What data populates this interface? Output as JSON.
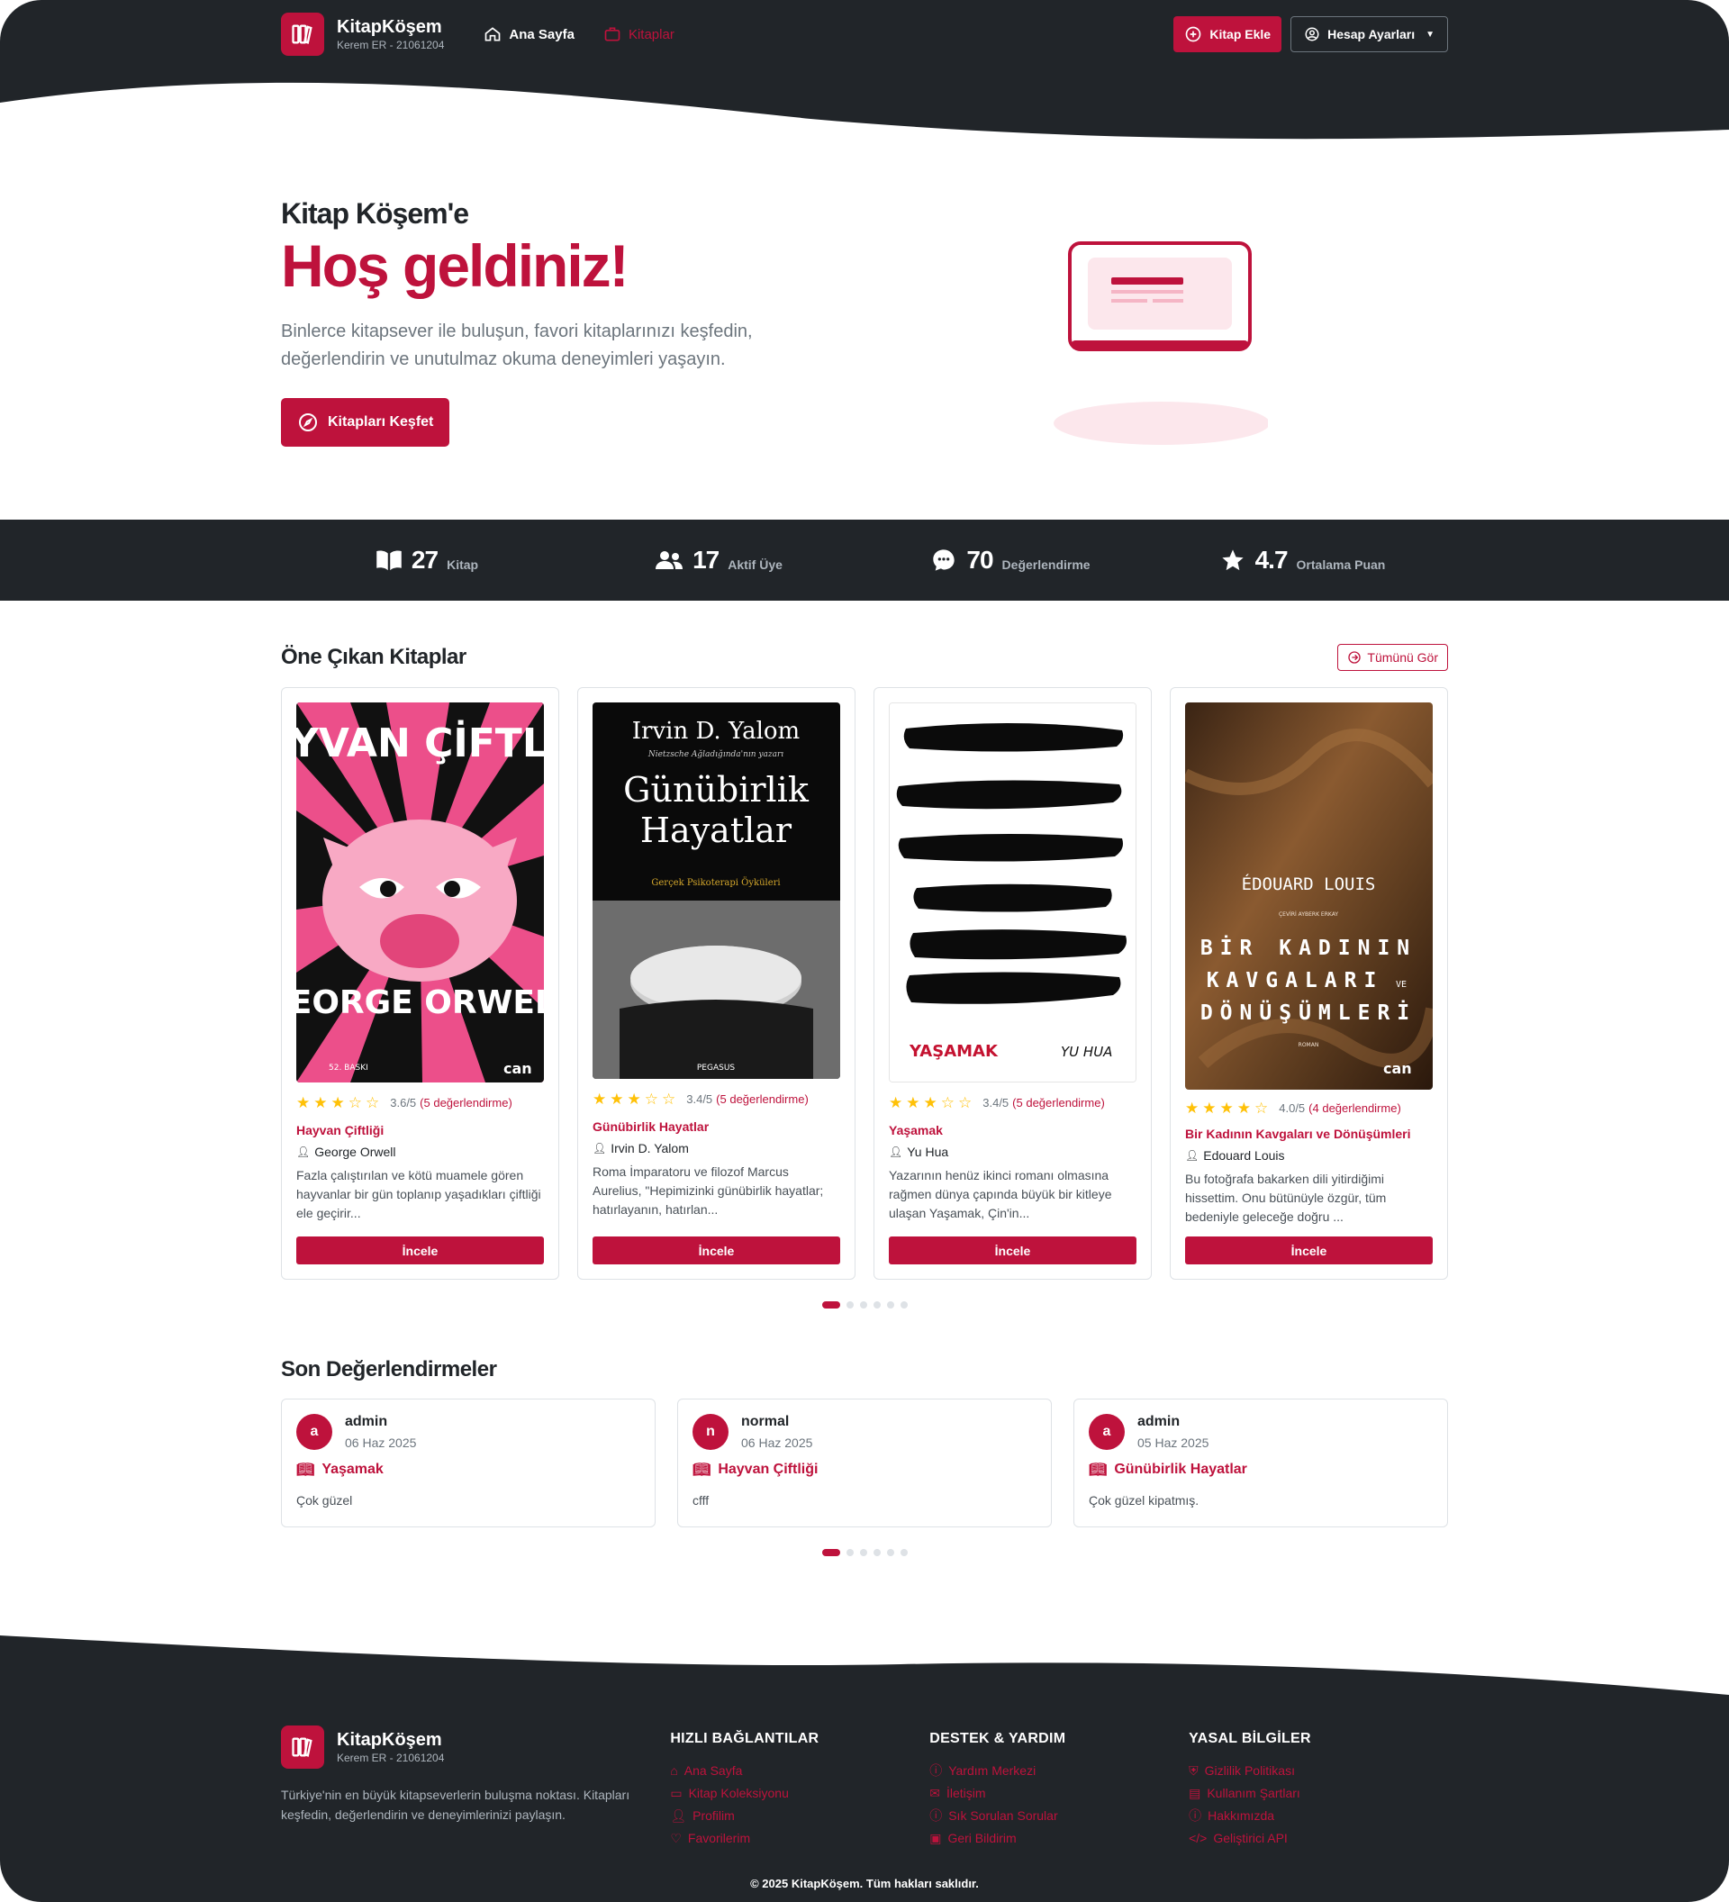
{
  "header": {
    "brand_name": "KitapKöşem",
    "brand_sub": "Kerem ER - 21061204",
    "nav": [
      {
        "label": "Ana Sayfa",
        "icon": "home-icon"
      },
      {
        "label": "Kitaplar",
        "icon": "briefcase-icon"
      }
    ],
    "add_book_label": "Kitap Ekle",
    "account_label": "Hesap Ayarları"
  },
  "hero": {
    "pre_title": "Kitap Köşem'e",
    "title": "Hoş geldiniz!",
    "description": "Binlerce kitapsever ile buluşun, favori kitaplarınızı keşfedin, değerlendirin ve unutulmaz okuma deneyimleri yaşayın.",
    "button_label": "Kitapları Keşfet"
  },
  "stats": [
    {
      "value": "27",
      "label": "Kitap",
      "icon": "book-icon"
    },
    {
      "value": "17",
      "label": "Aktif Üye",
      "icon": "users-icon"
    },
    {
      "value": "70",
      "label": "Değerlendirme",
      "icon": "chat-icon"
    },
    {
      "value": "4.7",
      "label": "Ortalama Puan",
      "icon": "star-icon"
    }
  ],
  "featured": {
    "title": "Öne Çıkan Kitaplar",
    "see_all_label": "Tümünü Gör",
    "review_button": "İncele",
    "books": [
      {
        "title": "Hayvan Çiftliği",
        "author": "George Orwell",
        "rating_text": "3.6/5",
        "count_text": "(5 değerlendirme)",
        "stars": 3,
        "desc": "Fazla çalıştırılan ve kötü muamele gören hayvanlar bir gün toplanıp yaşadıkları çiftliği ele geçirir...",
        "cover_top": "HAYVAN ÇİFTLİĞİ",
        "cover_bottom": "GEORGE ORWELL",
        "cover_small": "52. BASKI",
        "cover_publisher": "can"
      },
      {
        "title": "Günübirlik Hayatlar",
        "author": "Irvin D. Yalom",
        "rating_text": "3.4/5",
        "count_text": "(5 değerlendirme)",
        "stars": 3,
        "desc": "Roma İmparatoru ve filozof Marcus Aurelius, \"Hepimizinki günübirlik hayatlar; hatırlayanın, hatırlan...",
        "cover_top": "Irvin D. Yalom",
        "cover_sub": "Nietzsche Ağladığında'nın yazarı",
        "cover_mid": "Günübirlik Hayatlar",
        "cover_small": "Gerçek Psikoterapi Öyküleri",
        "cover_publisher": "PEGASUS"
      },
      {
        "title": "Yaşamak",
        "author": "Yu Hua",
        "rating_text": "3.4/5",
        "count_text": "(5 değerlendirme)",
        "stars": 3,
        "desc": "Yazarının henüz ikinci romanı olmasına rağmen dünya çapında büyük bir kitleye ulaşan Yaşamak, Çin'in...",
        "cover_top": "YAŞAMAK",
        "cover_bottom": "YU HUA"
      },
      {
        "title": "Bir Kadının Kavgaları ve Dönüşümleri",
        "author": "Edouard Louis",
        "rating_text": "4.0/5",
        "count_text": "(4 değerlendirme)",
        "stars": 4,
        "desc": "Bu fotoğrafa bakarken dili yitirdiğimi hissettim. Onu bütünüyle özgür, tüm bedeniyle geleceğe doğru ...",
        "cover_top": "ÉDOUARD LOUIS",
        "cover_small": "ÇEVİRİ AYBERK ERKAY",
        "cover_l1": "BİR KADININ",
        "cover_l2": "KAVGALARI",
        "cover_l2b": "VE",
        "cover_l3": "DÖNÜŞÜMLERİ",
        "cover_roman": "ROMAN",
        "cover_publisher": "can"
      }
    ]
  },
  "reviews": {
    "title": "Son Değerlendirmeler",
    "items": [
      {
        "initial": "a",
        "user": "admin",
        "date": "06 Haz 2025",
        "book": "Yaşamak",
        "text": "Çok güzel"
      },
      {
        "initial": "n",
        "user": "normal",
        "date": "06 Haz 2025",
        "book": "Hayvan Çiftliği",
        "text": "cfff"
      },
      {
        "initial": "a",
        "user": "admin",
        "date": "05 Haz 2025",
        "book": "Günübirlik Hayatlar",
        "text": "Çok güzel kipatmış."
      }
    ]
  },
  "footer": {
    "brand_name": "KitapKöşem",
    "brand_sub": "Kerem ER - 21061204",
    "description": "Türkiye'nin en büyük kitapseverlerin buluşma noktası. Kitapları keşfedin, değerlendirin ve deneyimlerinizi paylaşın.",
    "columns": [
      {
        "title": "HIZLI BAĞLANTILAR",
        "links": [
          {
            "label": "Ana Sayfa",
            "icon": "home-icon"
          },
          {
            "label": "Kitap Koleksiyonu",
            "icon": "briefcase-icon"
          },
          {
            "label": "Profilim",
            "icon": "user-icon"
          },
          {
            "label": "Favorilerim",
            "icon": "heart-icon"
          }
        ]
      },
      {
        "title": "DESTEK & YARDIM",
        "links": [
          {
            "label": "Yardım Merkezi",
            "icon": "question-icon"
          },
          {
            "label": "İletişim",
            "icon": "mail-icon"
          },
          {
            "label": "Sık Sorulan Sorular",
            "icon": "question-icon"
          },
          {
            "label": "Geri Bildirim",
            "icon": "feedback-icon"
          }
        ]
      },
      {
        "title": "YASAL BİLGİLER",
        "links": [
          {
            "label": "Gizlilik Politikası",
            "icon": "shield-icon"
          },
          {
            "label": "Kullanım Şartları",
            "icon": "document-icon"
          },
          {
            "label": "Hakkımızda",
            "icon": "info-icon"
          },
          {
            "label": "Geliştirici API",
            "icon": "code-icon"
          }
        ]
      }
    ],
    "copyright": "© 2025 KitapKöşem. Tüm hakları saklıdır."
  },
  "colors": {
    "accent": "#be123c",
    "dark": "#212529",
    "star": "#ffc107"
  }
}
